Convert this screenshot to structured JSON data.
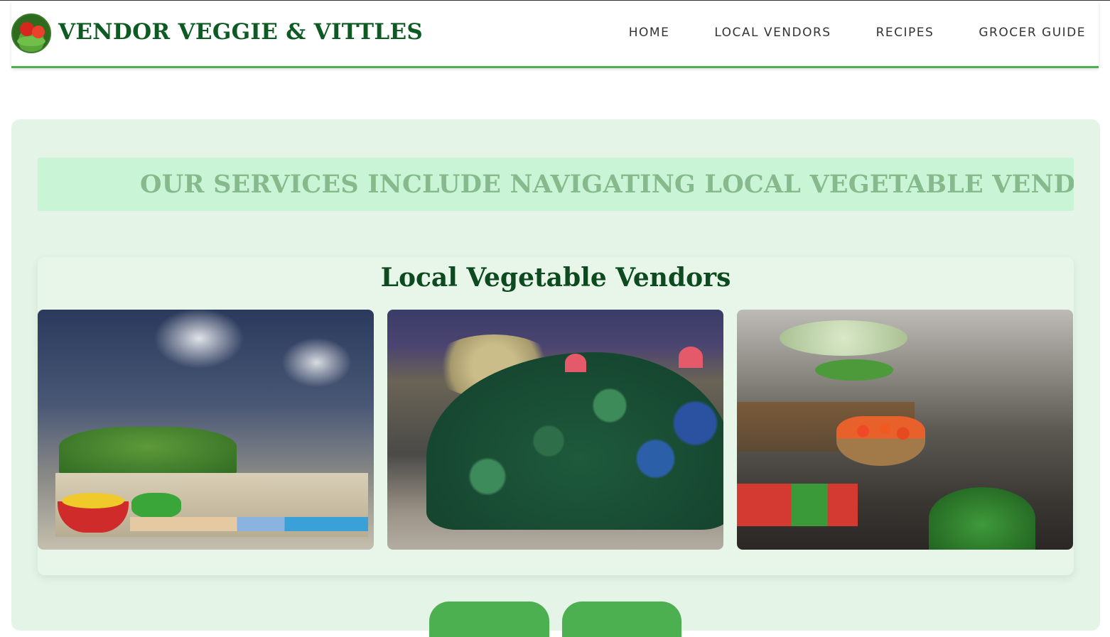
{
  "header": {
    "brand": "VENDOR VEGGIE & VITTLES",
    "logo_icon": "vegetables-logo-icon",
    "nav": [
      {
        "label": "HOME"
      },
      {
        "label": "LOCAL VENDORS"
      },
      {
        "label": "RECIPES"
      },
      {
        "label": "GROCER GUIDE"
      }
    ]
  },
  "banner": {
    "text": "OUR SERVICES INCLUDE NAVIGATING LOCAL VEGETABLE VENDORS AND EX"
  },
  "vendors": {
    "title": "Local Vegetable Vendors",
    "photos": [
      {
        "subject": "night vegetable stall with greens, lemons and peppers"
      },
      {
        "subject": "pile of watermelons and melons at night"
      },
      {
        "subject": "vegetable stall with tomatoes, beans and cabbages"
      }
    ]
  },
  "colors": {
    "accent": "#4caf50",
    "brand_text": "#0d5a23",
    "panel_bg": "#e4f4e6",
    "banner_bg": "#c9f5d6",
    "banner_text": "#86b98b"
  }
}
